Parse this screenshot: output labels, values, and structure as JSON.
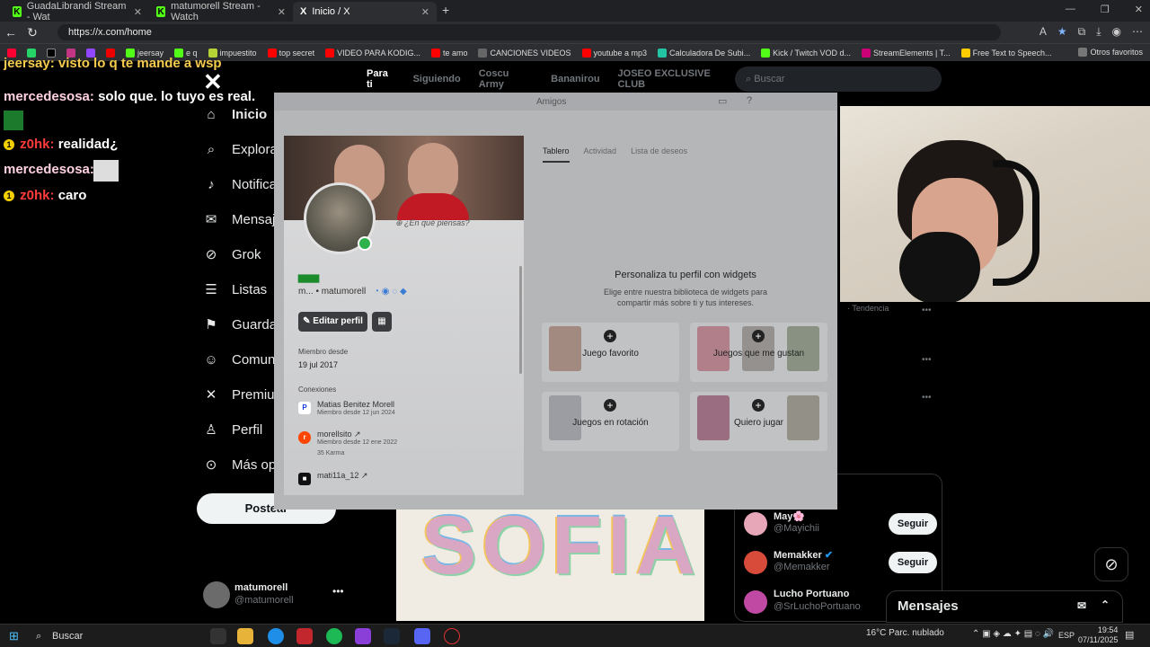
{
  "browser": {
    "tabs": [
      {
        "title": "GuadaLibrandi Stream - Wat"
      },
      {
        "title": "matumorell Stream - Watch"
      },
      {
        "title": "Inicio / X"
      }
    ],
    "url": "https://x.com/home",
    "bookmarks": [
      "jeersay",
      "e q",
      "impuestito",
      "top secret",
      "VIDEO PARA KODIG...",
      "te amo",
      "CANCIONES VIDEOS",
      "youtube a mp3",
      "Calculadora De Subi...",
      "Kick / Twitch VOD d...",
      "StreamElements | T...",
      "Free Text to Speech..."
    ],
    "other_bookmarks": "Otros favoritos"
  },
  "chat": {
    "partial_line": "jeersay: visto lo q te mande a wsp",
    "lines": [
      {
        "user": "mercedesosa:",
        "text": "solo que. lo tuyo es real."
      },
      {
        "user": "z0hk:",
        "text": "realidad¿"
      },
      {
        "user": "mercedesosa:",
        "text": ""
      },
      {
        "user": "z0hk:",
        "text": "caro"
      }
    ]
  },
  "x": {
    "nav": [
      "Inicio",
      "Explorar",
      "Notificaciones",
      "Mensajes",
      "Grok",
      "Listas",
      "Guardados",
      "Comunidades",
      "Premium",
      "Perfil",
      "Más opciones"
    ],
    "post_label": "Postear",
    "account": {
      "name": "matumorell",
      "handle": "@matumorell"
    },
    "timeline_tabs": [
      "Para ti",
      "Siguiendo",
      "Coscu Army",
      "Bananirou",
      "JOSEO EXCLUSIVE CLUB"
    ],
    "search_placeholder": "Buscar",
    "trend_partial": "· Tendencia",
    "post_image_text": "SOFIA",
    "who_to_follow": [
      {
        "name": "May🌸",
        "handle": "@Mayichii",
        "btn": "Seguir"
      },
      {
        "name": "Memakker",
        "handle": "@Memakker",
        "btn": "Seguir"
      },
      {
        "name": "Lucho Portuano",
        "handle": "@SrLuchoPortuano",
        "btn": ""
      }
    ],
    "messages_label": "Mensajes"
  },
  "steam": {
    "friends_label": "Amigos",
    "think_placeholder": "¿En qué piensas?",
    "display_name": "▆▆▆",
    "handle_line": "m... • matumorell",
    "edit_profile": "Editar perfil",
    "member_since_label": "Miembro desde",
    "member_since": "19 jul 2017",
    "connections_label": "Conexiones",
    "connections": [
      {
        "name": "Matias Benitez Morell",
        "sub": "Miembro desde 12 jun 2024",
        "extra": ""
      },
      {
        "name": "morellsito ↗",
        "sub": "Miembro desde 12 ene 2022",
        "extra": "35 Karma"
      },
      {
        "name": "mati11a_12 ↗",
        "sub": "",
        "extra": ""
      }
    ],
    "tabs": [
      "Tablero",
      "Actividad",
      "Lista de deseos"
    ],
    "widgets_title": "Personaliza tu perfil con widgets",
    "widgets_desc": "Elige entre nuestra biblioteca de widgets para compartir más sobre ti y tus intereses.",
    "widgets": [
      "Juego favorito",
      "Juegos que me gustan",
      "Juegos en rotación",
      "Quiero jugar"
    ]
  },
  "taskbar": {
    "search": "Buscar",
    "weather": "16°C  Parc. nublado",
    "lang": "ESP",
    "time": "19:54",
    "date": "07/11/2025"
  }
}
